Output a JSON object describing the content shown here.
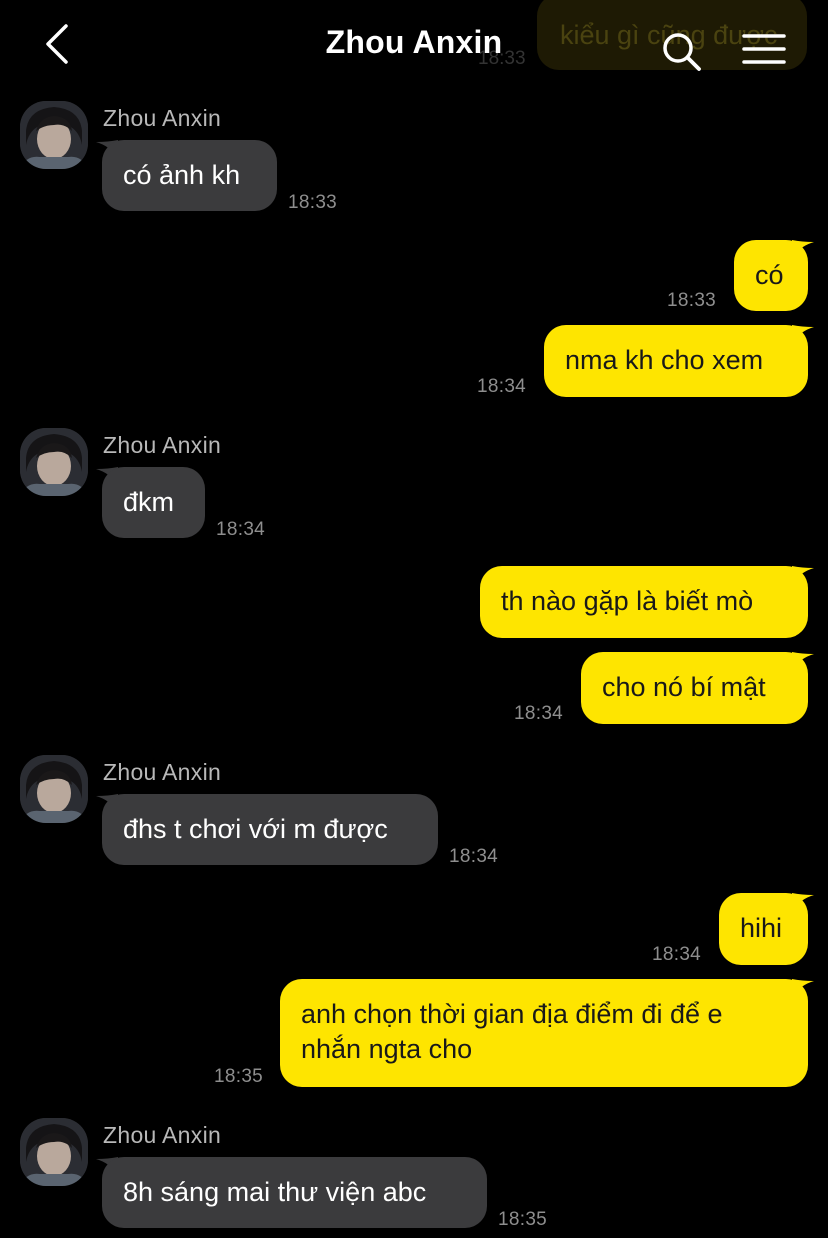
{
  "header": {
    "title": "Zhou Anxin"
  },
  "ghost": {
    "text": "kiểu gì cũng được",
    "time": "18:33"
  },
  "colors": {
    "background": "#000000",
    "incoming_bubble": "#3b3b3d",
    "outgoing_bubble": "#fee500",
    "outgoing_text": "#191919",
    "timestamp": "#8e8e8e"
  },
  "messages": [
    {
      "sender": "Zhou Anxin",
      "text": "có ảnh kh",
      "time": "18:33"
    },
    {
      "text": "có",
      "time": "18:33"
    },
    {
      "text": "nma kh cho xem",
      "time": "18:34"
    },
    {
      "sender": "Zhou Anxin",
      "text": "đkm",
      "time": "18:34"
    },
    {
      "text": "th nào gặp là biết mò"
    },
    {
      "text": "cho nó bí mật",
      "time": "18:34"
    },
    {
      "sender": "Zhou Anxin",
      "text": "đhs t chơi với m được",
      "time": "18:34"
    },
    {
      "text": "hihi",
      "time": "18:34"
    },
    {
      "text": "anh chọn thời gian địa điểm đi để e nhắn ngta cho",
      "time": "18:35"
    },
    {
      "sender": "Zhou Anxin",
      "text": "8h sáng mai thư viện abc",
      "time": "18:35"
    }
  ]
}
